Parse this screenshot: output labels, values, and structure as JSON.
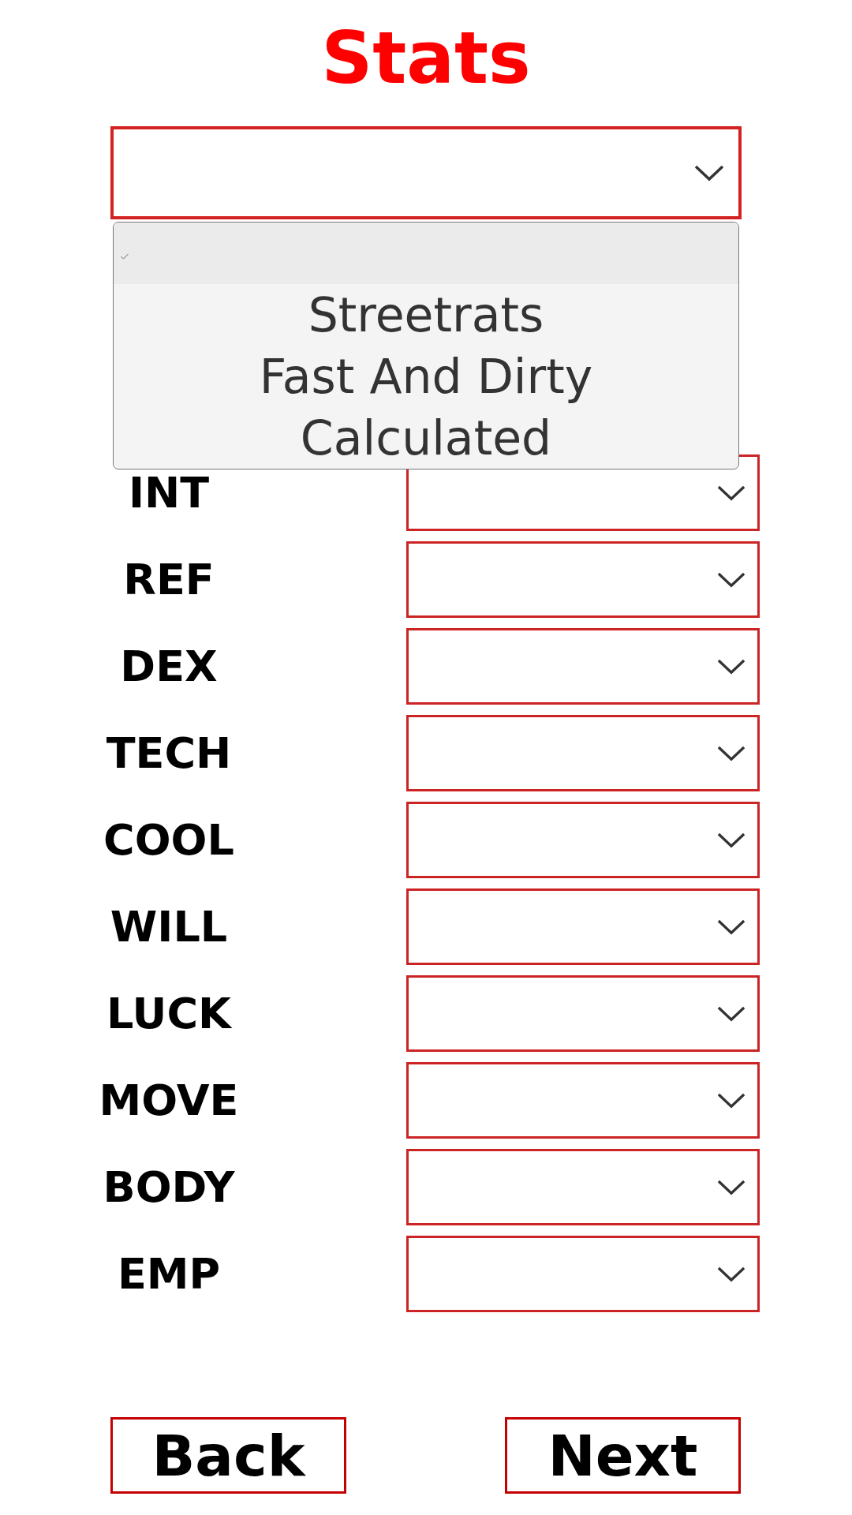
{
  "title": "Stats",
  "preset_select": {
    "expanded": true,
    "options": [
      {
        "selected": true
      },
      {
        "label": "Streetrats",
        "selected": false
      },
      {
        "label": "Fast And Dirty",
        "selected": false
      },
      {
        "label": "Calculated",
        "selected": false
      }
    ]
  },
  "stats": [
    {
      "label": "INT"
    },
    {
      "label": "REF"
    },
    {
      "label": "DEX"
    },
    {
      "label": "TECH"
    },
    {
      "label": "COOL"
    },
    {
      "label": "WILL"
    },
    {
      "label": "LUCK"
    },
    {
      "label": "MOVE"
    },
    {
      "label": "BODY"
    },
    {
      "label": "EMP"
    }
  ],
  "buttons": [
    {
      "label": "Back"
    },
    {
      "label": "Next"
    }
  ]
}
